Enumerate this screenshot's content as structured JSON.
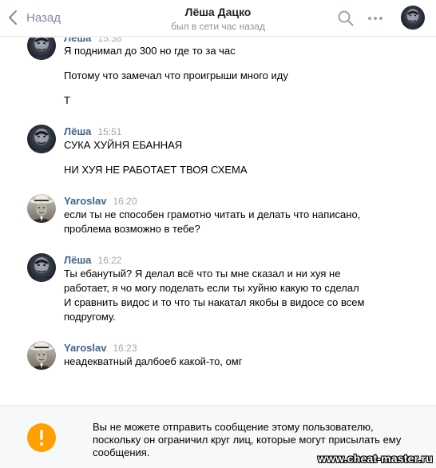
{
  "header": {
    "back_label": "Назад",
    "title": "Лёша Дацко",
    "status": "был в сети час назад"
  },
  "messages": [
    {
      "author": "Лёша",
      "time": "15:38",
      "avatar": "lesha",
      "lines": [
        "Я поднимал до 300 но где то за час",
        "Потому что замечал что проигрыши много иду",
        "Т"
      ]
    },
    {
      "author": "Лёша",
      "time": "15:51",
      "avatar": "lesha",
      "lines": [
        "СУКА ХУЙНЯ ЕБАННАЯ",
        "НИ ХУЯ НЕ РАБОТАЕТ ТВОЯ СХЕМА"
      ]
    },
    {
      "author": "Yaroslav",
      "time": "16:20",
      "avatar": "yaroslav",
      "lines": [
        "если ты не способен грамотно читать и делать что написано,",
        "проблема возможно в тебе?"
      ]
    },
    {
      "author": "Лёша",
      "time": "16:22",
      "avatar": "lesha",
      "lines": [
        "Ты ебанутый? Я делал всё что ты мне сказал и ни хуя не",
        "работает, я чо могу поделать если ты хуйню какую то сделал",
        "И сравнить видос и то что ты накатал якобы в видосе со всем",
        "подругому."
      ]
    },
    {
      "author": "Yaroslav",
      "time": "16:23",
      "avatar": "yaroslav",
      "lines": [
        "неадекватный далбоеб какой-то, омг"
      ]
    }
  ],
  "notice": {
    "icon": "exclamation-icon",
    "text": "Вы не можете отправить сообщение этому пользователю, поскольку он ограничил круг лиц, которые могут присылать ему сообщения."
  },
  "watermark": "www.cheat-master.ru",
  "colors": {
    "author": "#42648b",
    "time": "#a0a8b3",
    "warning": "#ffa000",
    "notice_bg": "#f7f8fa"
  }
}
